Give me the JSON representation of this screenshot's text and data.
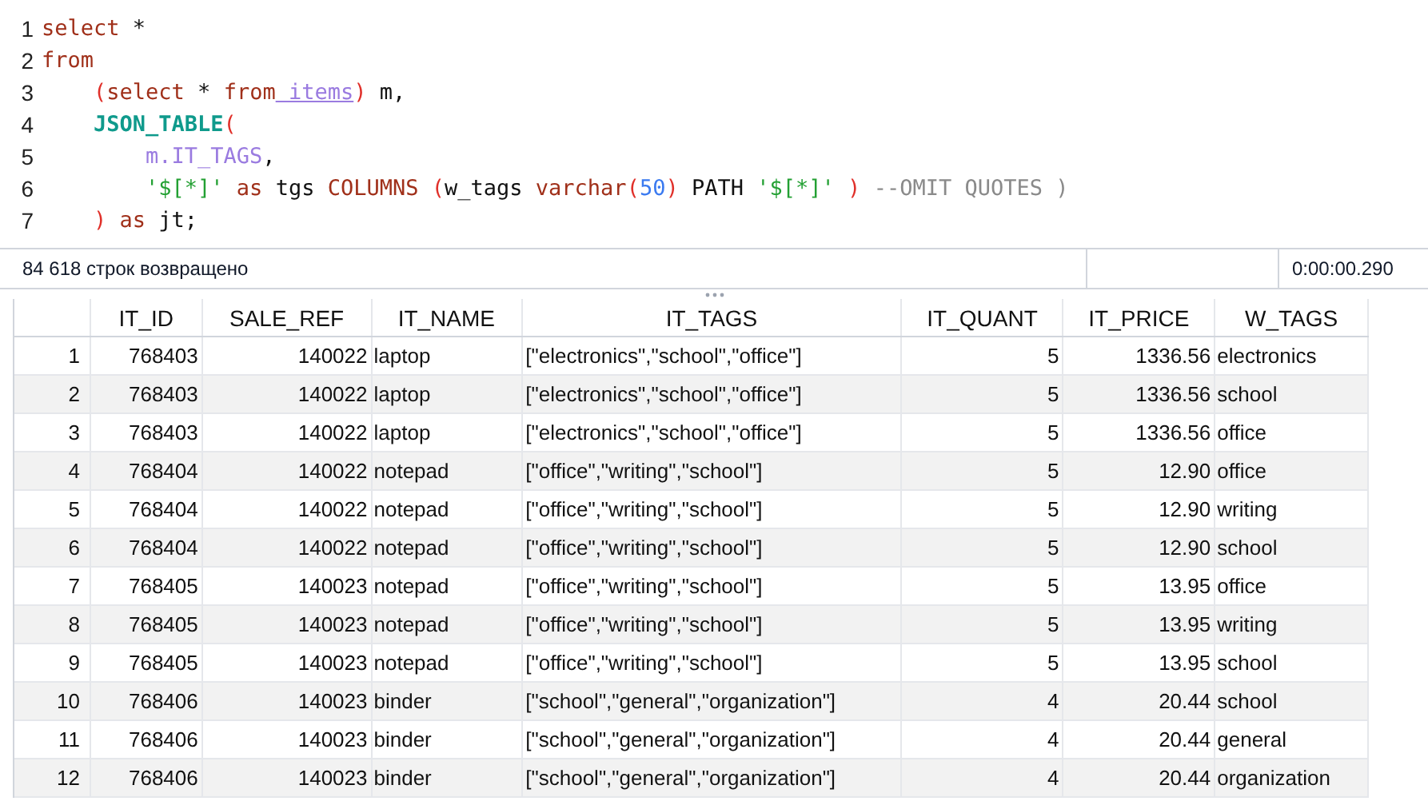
{
  "editor": {
    "lines": [
      {
        "number": "1",
        "tokens": [
          {
            "kind": "kw",
            "text": "select"
          },
          {
            "kind": "plain",
            "text": " *"
          }
        ]
      },
      {
        "number": "2",
        "tokens": [
          {
            "kind": "kw",
            "text": "from"
          }
        ]
      },
      {
        "number": "3",
        "tokens": [
          {
            "kind": "paren",
            "text": "    ("
          },
          {
            "kind": "kw",
            "text": "select"
          },
          {
            "kind": "plain",
            "text": " * "
          },
          {
            "kind": "kw",
            "text": "from"
          },
          {
            "kind": "link",
            "text": " items"
          },
          {
            "kind": "paren",
            "text": ")"
          },
          {
            "kind": "plain",
            "text": " m,"
          }
        ]
      },
      {
        "number": "4",
        "tokens": [
          {
            "kind": "func",
            "text": "    JSON_TABLE"
          },
          {
            "kind": "paren",
            "text": "("
          }
        ]
      },
      {
        "number": "5",
        "tokens": [
          {
            "kind": "ident",
            "text": "        m.IT_TAGS"
          },
          {
            "kind": "plain",
            "text": ","
          }
        ]
      },
      {
        "number": "6",
        "tokens": [
          {
            "kind": "str",
            "text": "        '$[*]'"
          },
          {
            "kind": "kw",
            "text": " as"
          },
          {
            "kind": "plain",
            "text": " tgs "
          },
          {
            "kind": "kw",
            "text": "COLUMNS"
          },
          {
            "kind": "paren",
            "text": " ("
          },
          {
            "kind": "plain",
            "text": "w_tags "
          },
          {
            "kind": "kw",
            "text": "varchar"
          },
          {
            "kind": "paren",
            "text": "("
          },
          {
            "kind": "num",
            "text": "50"
          },
          {
            "kind": "paren",
            "text": ")"
          },
          {
            "kind": "plain",
            "text": " PATH "
          },
          {
            "kind": "str",
            "text": "'$[*]'"
          },
          {
            "kind": "paren",
            "text": " )"
          },
          {
            "kind": "comment",
            "text": " --OMIT QUOTES )"
          }
        ]
      },
      {
        "number": "7",
        "tokens": [
          {
            "kind": "paren",
            "text": "    )"
          },
          {
            "kind": "kw",
            "text": " as"
          },
          {
            "kind": "plain",
            "text": " jt;"
          }
        ]
      }
    ]
  },
  "status_bar": {
    "rows_returned": "84 618 строк возвращено",
    "elapsed": "0:00:00.290"
  },
  "table": {
    "columns": [
      "",
      "IT_ID",
      "SALE_REF",
      "IT_NAME",
      "IT_TAGS",
      "IT_QUANT",
      "IT_PRICE",
      "W_TAGS"
    ],
    "rows": [
      [
        "1",
        "768403",
        "140022",
        "laptop",
        "[\"electronics\",\"school\",\"office\"]",
        "5",
        "1336.56",
        "electronics"
      ],
      [
        "2",
        "768403",
        "140022",
        "laptop",
        "[\"electronics\",\"school\",\"office\"]",
        "5",
        "1336.56",
        "school"
      ],
      [
        "3",
        "768403",
        "140022",
        "laptop",
        "[\"electronics\",\"school\",\"office\"]",
        "5",
        "1336.56",
        "office"
      ],
      [
        "4",
        "768404",
        "140022",
        "notepad",
        "[\"office\",\"writing\",\"school\"]",
        "5",
        "12.90",
        "office"
      ],
      [
        "5",
        "768404",
        "140022",
        "notepad",
        "[\"office\",\"writing\",\"school\"]",
        "5",
        "12.90",
        "writing"
      ],
      [
        "6",
        "768404",
        "140022",
        "notepad",
        "[\"office\",\"writing\",\"school\"]",
        "5",
        "12.90",
        "school"
      ],
      [
        "7",
        "768405",
        "140023",
        "notepad",
        "[\"office\",\"writing\",\"school\"]",
        "5",
        "13.95",
        "office"
      ],
      [
        "8",
        "768405",
        "140023",
        "notepad",
        "[\"office\",\"writing\",\"school\"]",
        "5",
        "13.95",
        "writing"
      ],
      [
        "9",
        "768405",
        "140023",
        "notepad",
        "[\"office\",\"writing\",\"school\"]",
        "5",
        "13.95",
        "school"
      ],
      [
        "10",
        "768406",
        "140023",
        "binder",
        "[\"school\",\"general\",\"organization\"]",
        "4",
        "20.44",
        "school"
      ],
      [
        "11",
        "768406",
        "140023",
        "binder",
        "[\"school\",\"general\",\"organization\"]",
        "4",
        "20.44",
        "general"
      ],
      [
        "12",
        "768406",
        "140023",
        "binder",
        "[\"school\",\"general\",\"organization\"]",
        "4",
        "20.44",
        "organization"
      ]
    ]
  }
}
